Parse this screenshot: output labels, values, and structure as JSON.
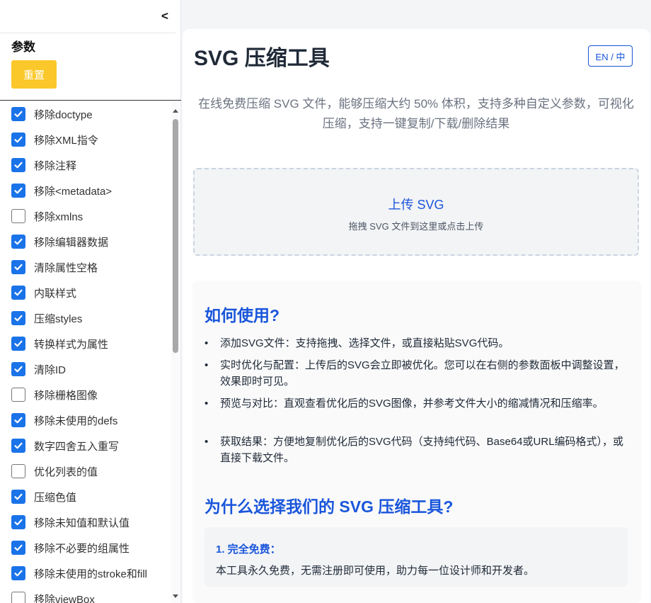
{
  "sidebar": {
    "collapse_label": "<",
    "title": "参数",
    "reset_label": "重置",
    "options": [
      {
        "label": "移除doctype",
        "checked": true
      },
      {
        "label": "移除XML指令",
        "checked": true
      },
      {
        "label": "移除注释",
        "checked": true
      },
      {
        "label": "移除<metadata>",
        "checked": true
      },
      {
        "label": "移除xmlns",
        "checked": false
      },
      {
        "label": "移除编辑器数据",
        "checked": true
      },
      {
        "label": "清除属性空格",
        "checked": true
      },
      {
        "label": "内联样式",
        "checked": true
      },
      {
        "label": "压缩styles",
        "checked": true
      },
      {
        "label": "转换样式为属性",
        "checked": true
      },
      {
        "label": "清除ID",
        "checked": true
      },
      {
        "label": "移除栅格图像",
        "checked": false
      },
      {
        "label": "移除未使用的defs",
        "checked": true
      },
      {
        "label": "数字四舍五入重写",
        "checked": true
      },
      {
        "label": "优化列表的值",
        "checked": false
      },
      {
        "label": "压缩色值",
        "checked": true
      },
      {
        "label": "移除未知值和默认值",
        "checked": true
      },
      {
        "label": "移除不必要的组属性",
        "checked": true
      },
      {
        "label": "移除未使用的stroke和fill",
        "checked": true
      },
      {
        "label": "移除viewBox",
        "checked": false
      }
    ]
  },
  "main": {
    "title": "SVG 压缩工具",
    "lang_toggle": "EN / 中",
    "subtitle": "在线免费压缩 SVG 文件，能够压缩大约 50% 体积，支持多种自定义参数，可视化压缩，支持一键复制/下载/删除结果",
    "upload": {
      "title": "上传 SVG",
      "hint": "拖拽 SVG 文件到这里或点击上传"
    },
    "howto": {
      "heading": "如何使用?",
      "items": [
        "添加SVG文件：支持拖拽、选择文件，或直接粘贴SVG代码。",
        "实时优化与配置：上传后的SVG会立即被优化。您可以在右侧的参数面板中调整设置，效果即时可见。",
        "预览与对比：直观查看优化后的SVG图像，并参考文件大小的缩减情况和压缩率。",
        "获取结果：方便地复制优化后的SVG代码（支持纯代码、Base64或URL编码格式），或直接下载文件。"
      ]
    },
    "why": {
      "heading": "为什么选择我们的 SVG 压缩工具?",
      "feature_title": "1. 完全免费：",
      "feature_desc": "本工具永久免费，无需注册即可使用，助力每一位设计师和开发者。"
    }
  },
  "colors": {
    "accent": "#1a73e8",
    "heading_blue": "#1a56db",
    "reset_button": "#fbc82b"
  }
}
